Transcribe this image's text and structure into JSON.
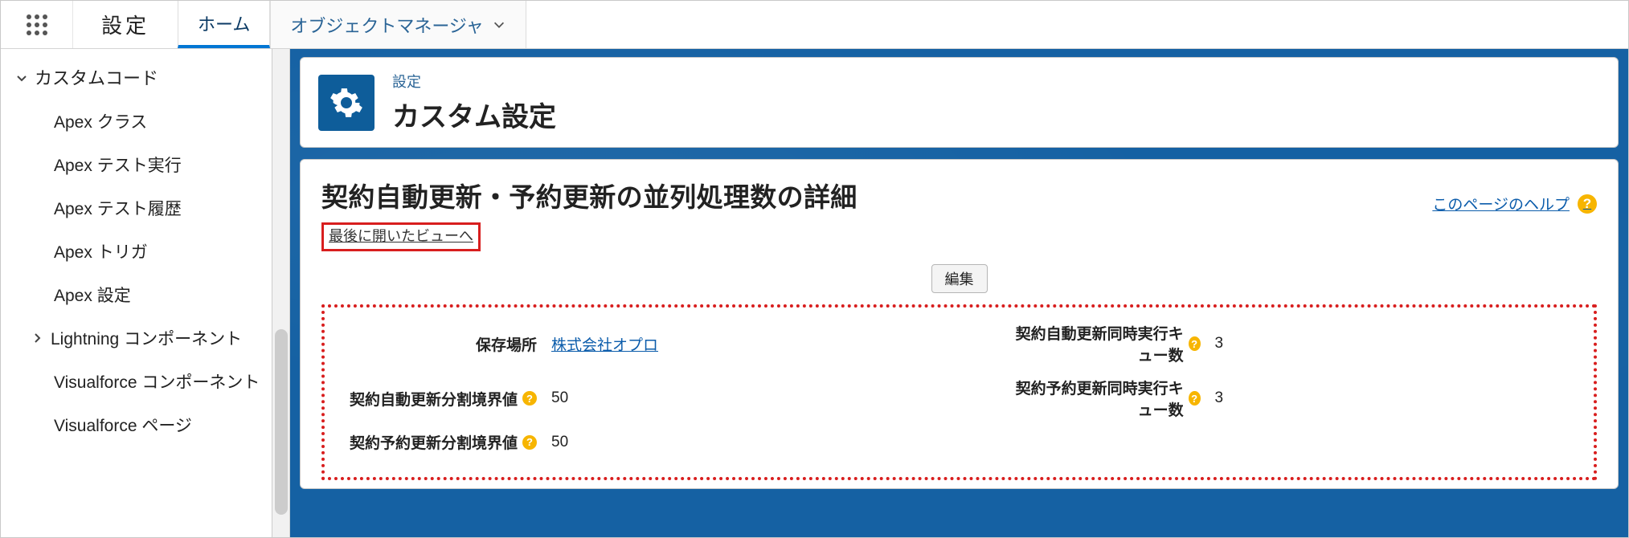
{
  "topbar": {
    "app_name": "設定",
    "tabs": [
      {
        "label": "ホーム",
        "active": true
      },
      {
        "label": "オブジェクトマネージャ",
        "active": false,
        "has_chevron": true
      }
    ]
  },
  "sidebar": {
    "root_label": "カスタムコード",
    "items": [
      {
        "label": "Apex クラス"
      },
      {
        "label": "Apex テスト実行"
      },
      {
        "label": "Apex テスト履歴"
      },
      {
        "label": "Apex トリガ"
      },
      {
        "label": "Apex 設定"
      },
      {
        "label": "Lightning コンポーネント",
        "has_chevron": true
      },
      {
        "label": "Visualforce コンポーネント"
      },
      {
        "label": "Visualforce ページ"
      }
    ]
  },
  "header": {
    "crumb": "設定",
    "title": "カスタム設定"
  },
  "content": {
    "page_title": "契約自動更新・予約更新の並列処理数の詳細",
    "help_link": "このページのヘルプ",
    "back_link": "最後に開いたビューへ",
    "edit_button": "編集",
    "rows": {
      "r0": {
        "label": "保存場所",
        "value": "株式会社オプロ",
        "help": false,
        "link": true
      },
      "r1": {
        "label": "契約自動更新同時実行キュー数",
        "value": "3",
        "help": true,
        "link": false
      },
      "r2": {
        "label": "契約自動更新分割境界値",
        "value": "50",
        "help": true,
        "link": false
      },
      "r3": {
        "label": "契約予約更新同時実行キュー数",
        "value": "3",
        "help": true,
        "link": false
      },
      "r4": {
        "label": "契約予約更新分割境界値",
        "value": "50",
        "help": true,
        "link": false
      }
    }
  }
}
